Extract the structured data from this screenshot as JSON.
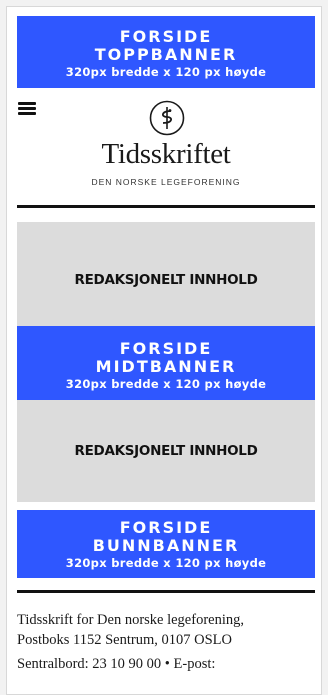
{
  "banners": {
    "top": {
      "line1": "FORSIDE",
      "line2": "TOPPBANNER",
      "size": "320px bredde x 120 px høyde"
    },
    "middle": {
      "line1": "FORSIDE",
      "line2": "MIDTBANNER",
      "size": "320px bredde x 120 px høyde"
    },
    "bottom": {
      "line1": "FORSIDE",
      "line2": "BUNNBANNER",
      "size": "320px bredde x 120 px høyde"
    }
  },
  "header": {
    "logo_name": "Tidsskriftet",
    "logo_subtitle": "DEN NORSKE LEGEFORENING",
    "menu_icon": "hamburger-menu-icon",
    "logo_icon": "caduceus-icon"
  },
  "content_blocks": [
    {
      "label": "REDAKSJONELT INNHOLD"
    },
    {
      "label": "REDAKSJONELT INNHOLD"
    }
  ],
  "footer": {
    "line1": "Tidsskrift for Den norske legeforening,",
    "line2": "Postboks 1152 Sentrum, 0107 OSLO",
    "line3": "Sentralbord: 23 10 90 00 • E-post:"
  },
  "colors": {
    "banner_blue": "#2f57ff",
    "content_gray": "#dcdcdc"
  }
}
